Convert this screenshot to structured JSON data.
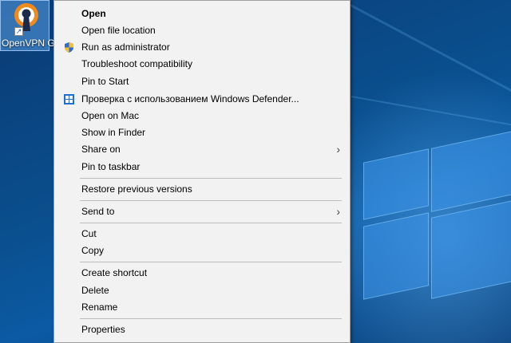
{
  "desktop": {
    "icon_label": "OpenVPN GUI",
    "accent": "#0a4f8a"
  },
  "menu": {
    "items": [
      {
        "label": "Open",
        "bold": true
      },
      {
        "label": "Open file location"
      },
      {
        "label": "Run as administrator",
        "icon": "uac-shield-icon"
      },
      {
        "label": "Troubleshoot compatibility"
      },
      {
        "label": "Pin to Start"
      },
      {
        "label": "Проверка с использованием Windows Defender...",
        "icon": "windows-defender-icon"
      },
      {
        "label": "Open on Mac"
      },
      {
        "label": "Show in Finder"
      },
      {
        "label": "Share on",
        "submenu": true
      },
      {
        "label": "Pin to taskbar"
      },
      {
        "label": "Restore previous versions"
      },
      {
        "label": "Send to",
        "submenu": true
      },
      {
        "label": "Cut"
      },
      {
        "label": "Copy"
      },
      {
        "label": "Create shortcut"
      },
      {
        "label": "Delete"
      },
      {
        "label": "Rename"
      },
      {
        "label": "Properties"
      }
    ]
  }
}
